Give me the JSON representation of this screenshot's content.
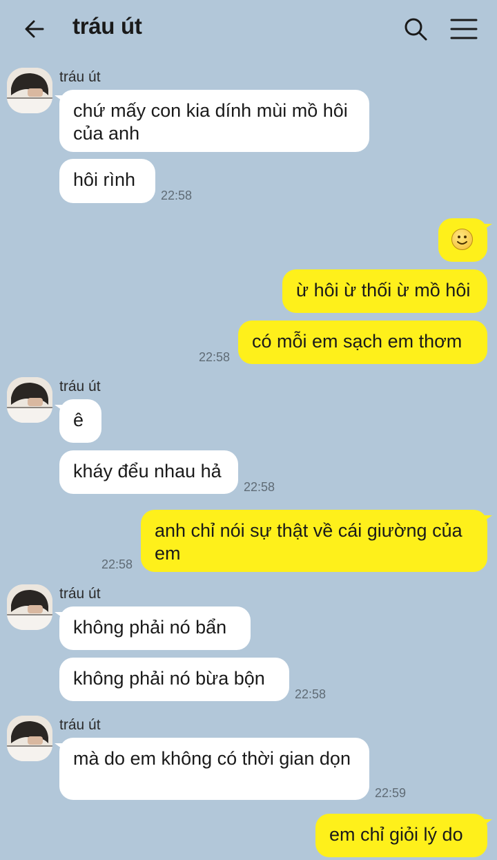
{
  "header": {
    "title": "tráu út",
    "back_icon": "arrow-left-icon",
    "search_icon": "search-icon",
    "menu_icon": "hamburger-menu-icon"
  },
  "colors": {
    "background": "#b2c7d9",
    "incoming": "#ffffff",
    "outgoing": "#fef01b"
  },
  "messages": [
    {
      "sender": "tráu út",
      "text": "chứ mấy con kia dính mùi mồ hôi của anh"
    },
    {
      "text": "hôi rình",
      "time": "22:58"
    },
    {
      "emoji": "smiling-face-emoji"
    },
    {
      "text": "ừ hôi ừ thối ừ mồ hôi"
    },
    {
      "text": "có mỗi em sạch em thơm",
      "time": "22:58"
    },
    {
      "sender": "tráu út",
      "text": "ê"
    },
    {
      "text": "kháy đểu nhau hả",
      "time": "22:58"
    },
    {
      "text": "anh chỉ nói sự thật về cái giường của em",
      "time": "22:58"
    },
    {
      "sender": "tráu út",
      "text": "không phải nó bẩn"
    },
    {
      "text": "không phải nó bừa bộn",
      "time": "22:58"
    },
    {
      "sender": "tráu út",
      "text": "mà do em không có thời gian dọn",
      "time": "22:59"
    },
    {
      "text": "em chỉ giỏi lý do"
    }
  ]
}
